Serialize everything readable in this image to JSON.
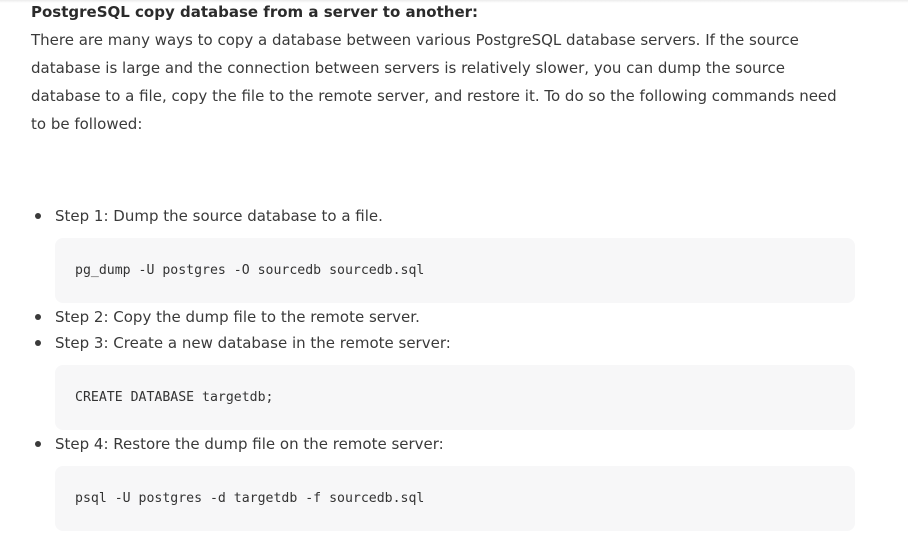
{
  "article": {
    "heading": "PostgreSQL copy database from a server to another:",
    "intro": "There are many ways to copy a database between various PostgreSQL database servers. If the source database is large and the connection between servers is relatively slower, you can dump the source database to a file, copy the file to the remote server, and restore it. To do so the following commands need to be followed:",
    "steps": [
      {
        "text": "Step 1: Dump the source database to a file.",
        "code": "pg_dump -U postgres -O sourcedb sourcedb.sql"
      },
      {
        "text": "Step 2: Copy the dump file to the remote server.",
        "code": ""
      },
      {
        "text": "Step 3: Create a new database in the remote server:",
        "code": "CREATE DATABASE targetdb;"
      },
      {
        "text": "Step 4: Restore the dump file on the remote server:",
        "code": "psql -U postgres -d targetdb -f sourcedb.sql"
      }
    ]
  }
}
